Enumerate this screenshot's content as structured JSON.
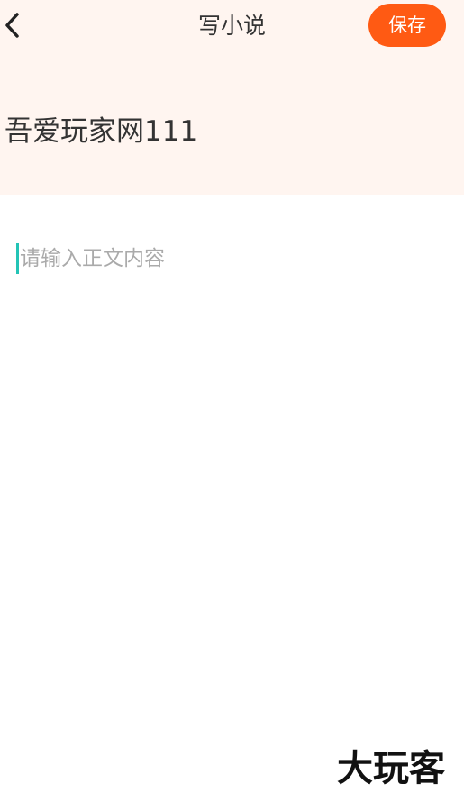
{
  "header": {
    "back_icon": "chevron-left-icon",
    "title": "写小说",
    "save_label": "保存",
    "background": "#fff5f0",
    "save_color": "#ff5a13"
  },
  "novel_title": {
    "value": "吾爱玩家网111"
  },
  "content": {
    "placeholder": "请输入正文内容",
    "caret_color": "#23c4b6"
  },
  "watermark": {
    "text": "大玩客"
  }
}
